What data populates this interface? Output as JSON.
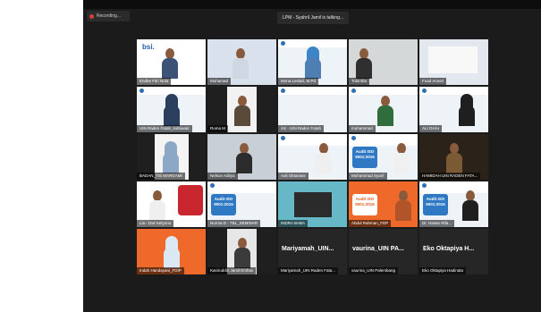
{
  "recording": {
    "label": "Recording..."
  },
  "speaker": {
    "label": "LPM - Syahril Jamil is talking..."
  },
  "tiles": [
    {
      "name": "Endhe Fitri Nola"
    },
    {
      "name": "Muhamad"
    },
    {
      "name": "Mona Lestari, M.Pd"
    },
    {
      "name": "Tobimba"
    },
    {
      "name": "Fuad Ansori"
    },
    {
      "name": "UIN Raden Fatah_indrawati"
    },
    {
      "name": "Roma M"
    },
    {
      "name": "AS - UIN Raden Fatah"
    },
    {
      "name": "muhammad"
    },
    {
      "name": "ALI GHAI"
    },
    {
      "name": "BADAN_TIS MARGAMI"
    },
    {
      "name": "Nelson Aditya"
    },
    {
      "name": "Auli Oktaviani"
    },
    {
      "name": "Muhammad Syarif"
    },
    {
      "name": "HAMIDAH UIN RADEN FATA..."
    },
    {
      "name": "Lia - Dwi Setyono"
    },
    {
      "name": "Nurma D - TBL_SEMINAR"
    },
    {
      "name": "INDRA BABA"
    },
    {
      "name": "Abdul Rahman_FDP"
    },
    {
      "name": "Dr. Hasan Rifa..."
    },
    {
      "name": "Indah Handayani_FDIP"
    },
    {
      "name": "Kasiruddin Jamil Emhas"
    },
    {
      "name": "Mariyamah_UIN Raden Fata..."
    },
    {
      "name": "vaurina_UIN Palembang"
    },
    {
      "name": "Eko Oktapiya Hadinata"
    }
  ],
  "name_tiles": {
    "mariyamah": "Mariyamah_UIN...",
    "vaurina": "vaurina_UIN PA...",
    "eko": "Eko Oktapiya H..."
  },
  "slides": {
    "bsi_text": "bsi.",
    "audit_iso": "Audit ISO 9001:2015",
    "fakultas": "Fakultas Sains dan Teknologi UIN Raden Fatah Palembang"
  }
}
